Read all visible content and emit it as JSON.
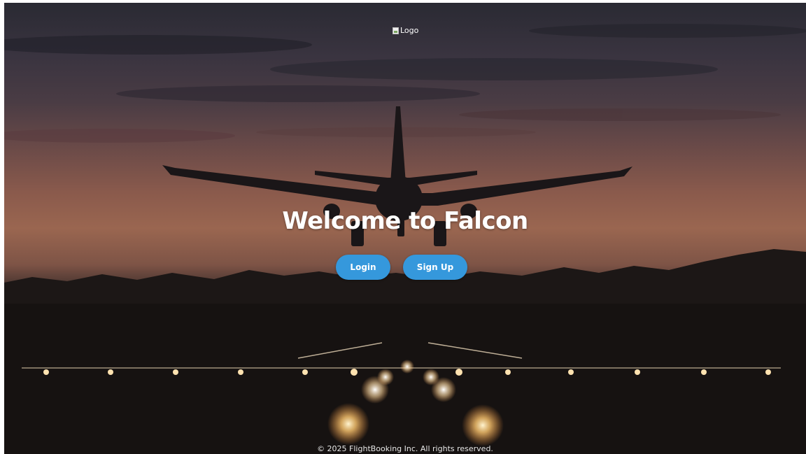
{
  "header": {
    "logo_alt": "Logo"
  },
  "hero": {
    "title": "Welcome to Falcon",
    "login_label": "Login",
    "signup_label": "Sign Up"
  },
  "footer": {
    "copyright": "© 2025 FlightBooking Inc. All rights reserved."
  },
  "colors": {
    "button": "#3598dc",
    "text": "#ffffff"
  }
}
